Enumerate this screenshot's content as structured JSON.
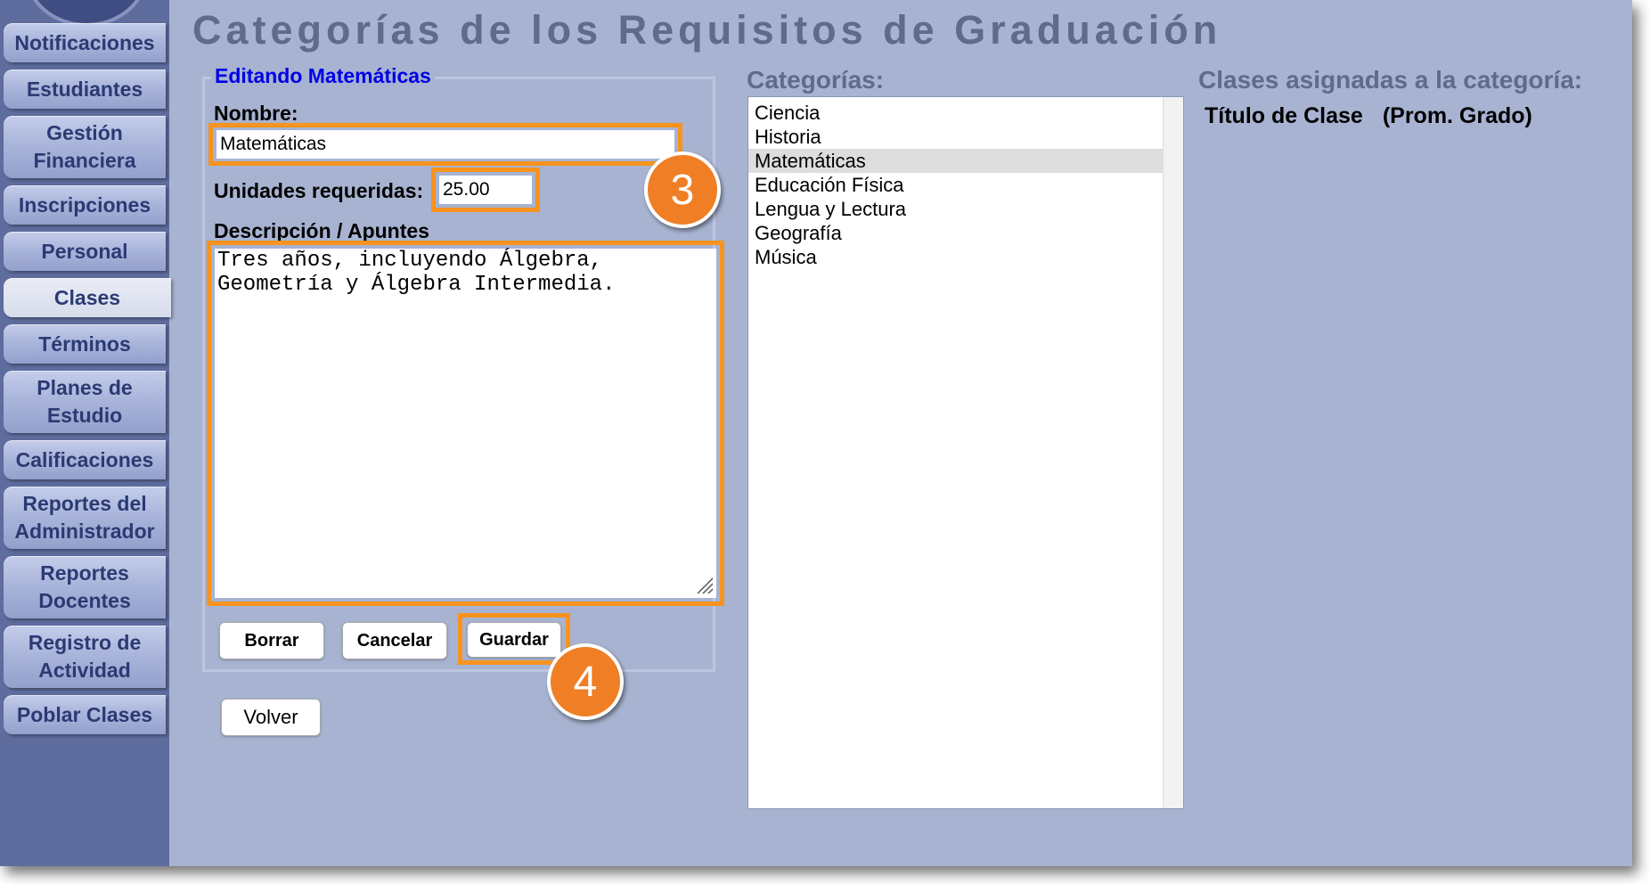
{
  "sidebar": {
    "items": [
      {
        "label": "Notificaciones"
      },
      {
        "label": "Estudiantes"
      },
      {
        "label": "Gestión\nFinanciera"
      },
      {
        "label": "Inscripciones"
      },
      {
        "label": "Personal"
      },
      {
        "label": "Clases",
        "active": true
      },
      {
        "label": "Términos"
      },
      {
        "label": "Planes de\nEstudio"
      },
      {
        "label": "Calificaciones"
      },
      {
        "label": "Reportes del\nAdministrador"
      },
      {
        "label": "Reportes\nDocentes"
      },
      {
        "label": "Registro de\nActividad"
      },
      {
        "label": "Poblar Clases"
      }
    ]
  },
  "page": {
    "title": "Categorías de los Requisitos de Graduación"
  },
  "edit": {
    "legend": "Editando Matemáticas",
    "name_label": "Nombre:",
    "name_value": "Matemáticas",
    "units_label": "Unidades requeridas:",
    "units_value": "25.00",
    "desc_label": "Descripción / Apuntes",
    "desc_value": "Tres años, incluyendo Álgebra,\nGeometría y Álgebra Intermedia.",
    "delete_label": "Borrar",
    "cancel_label": "Cancelar",
    "save_label": "Guardar"
  },
  "back_label": "Volver",
  "badges": {
    "step3": "3",
    "step4": "4"
  },
  "categories": {
    "heading": "Categorías:",
    "items": [
      {
        "label": "Ciencia"
      },
      {
        "label": "Historia"
      },
      {
        "label": "Matemáticas",
        "selected": true
      },
      {
        "label": "Educación Física"
      },
      {
        "label": "Lengua y Lectura"
      },
      {
        "label": "Geografía"
      },
      {
        "label": "Música"
      }
    ]
  },
  "assigned": {
    "heading": "Clases asignadas a la categoría:",
    "col_title": "Título de Clase",
    "col_avg": "(Prom. Grado)"
  },
  "colors": {
    "highlight": "#f7931e",
    "badge": "#f07e24",
    "background": "#a7b3d1",
    "sidebar": "#5f6d9e",
    "legend": "#0000e6"
  }
}
